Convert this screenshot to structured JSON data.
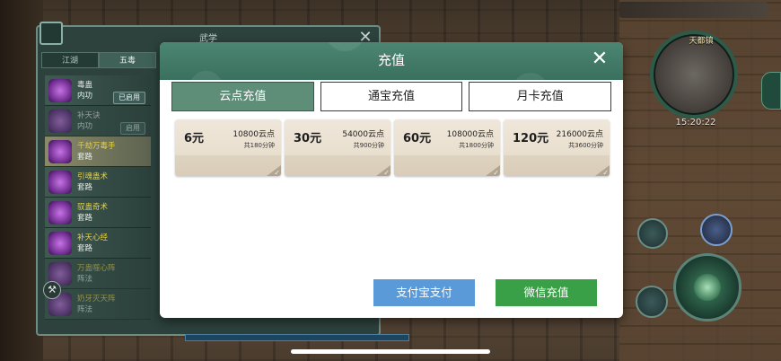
{
  "game_hud": {
    "location_name": "天都镇",
    "time": "15:20:22"
  },
  "skill_panel": {
    "title": "武学",
    "close_glyph": "✕",
    "tabs": [
      {
        "label": "江湖",
        "active": false
      },
      {
        "label": "五毒",
        "active": true
      }
    ],
    "items": [
      {
        "name": "毒蛊",
        "type": "内功",
        "badge": "已启用"
      },
      {
        "name": "补天诀",
        "type": "内功",
        "badge": "启用"
      },
      {
        "name": "千劫万毒手",
        "type": "套路",
        "badge": ""
      },
      {
        "name": "引魂蛊术",
        "type": "套路",
        "badge": ""
      },
      {
        "name": "驭蛊奇术",
        "type": "套路",
        "badge": ""
      },
      {
        "name": "补天心经",
        "type": "套路",
        "badge": ""
      },
      {
        "name": "万蛊噬心阵",
        "type": "阵法",
        "badge": ""
      },
      {
        "name": "奶牙灭天阵",
        "type": "阵法",
        "badge": ""
      }
    ]
  },
  "modal": {
    "title": "充值",
    "close_glyph": "✕",
    "tabs": [
      {
        "label": "云点充值",
        "active": true
      },
      {
        "label": "通宝充值",
        "active": false
      },
      {
        "label": "月卡充值",
        "active": false
      }
    ],
    "packages": [
      {
        "price": "6元",
        "points": "10800云点",
        "minutes": "共180分钟"
      },
      {
        "price": "30元",
        "points": "54000云点",
        "minutes": "共900分钟"
      },
      {
        "price": "60元",
        "points": "108000云点",
        "minutes": "共1800分钟"
      },
      {
        "price": "120元",
        "points": "216000云点",
        "minutes": "共3600分钟"
      }
    ],
    "check_glyph": "✓",
    "buttons": {
      "alipay": "支付宝支付",
      "wechat": "微信充值"
    }
  },
  "colors": {
    "header_green": "#3f7a66",
    "active_tab": "#5e8d78",
    "alipay_blue": "#5a9ad8",
    "wechat_green": "#3aa048"
  }
}
